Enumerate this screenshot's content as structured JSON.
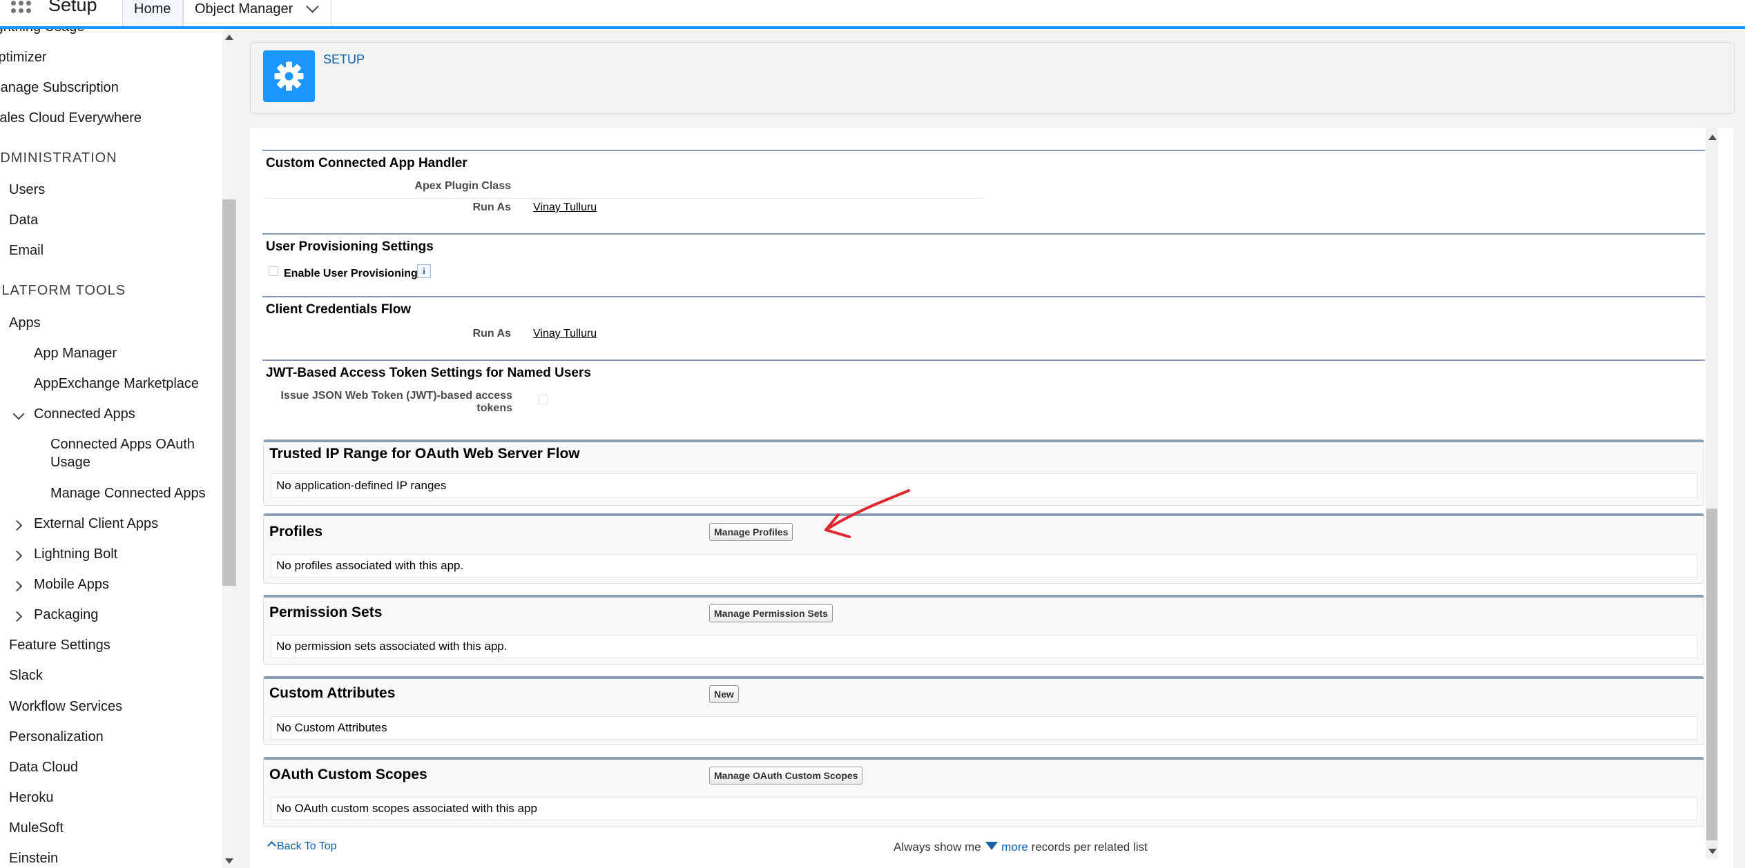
{
  "header": {
    "app_name": "Setup",
    "tabs": [
      {
        "label": "Home"
      },
      {
        "label": "Object Manager"
      }
    ]
  },
  "sidebar": {
    "items": {
      "lightning_usage": "Lightning Usage",
      "optimizer": "Optimizer",
      "manage_subscription": "Manage Subscription",
      "sales_cloud_everywhere": "Sales Cloud Everywhere",
      "administration": "ADMINISTRATION",
      "users": "Users",
      "data": "Data",
      "email": "Email",
      "platform_tools": "PLATFORM TOOLS",
      "apps": "Apps",
      "app_manager": "App Manager",
      "appexchange": "AppExchange Marketplace",
      "connected_apps": "Connected Apps",
      "connected_apps_oauth_1": "Connected Apps OAuth",
      "connected_apps_oauth_2": "Usage",
      "manage_connected_apps": "Manage Connected Apps",
      "external_client_apps": "External Client Apps",
      "lightning_bolt": "Lightning Bolt",
      "mobile_apps": "Mobile Apps",
      "packaging": "Packaging",
      "feature_settings": "Feature Settings",
      "slack": "Slack",
      "workflow_services": "Workflow Services",
      "personalization": "Personalization",
      "data_cloud": "Data Cloud",
      "heroku": "Heroku",
      "mulesoft": "MuleSoft",
      "einstein": "Einstein"
    }
  },
  "setup_header": {
    "label": "SETUP"
  },
  "sections": {
    "custom_handler": {
      "title": "Custom Connected App Handler",
      "apex_label": "Apex Plugin Class",
      "run_as_label": "Run As",
      "run_as_value": "Vinay Tulluru"
    },
    "user_provisioning": {
      "title": "User Provisioning Settings",
      "enable_label": "Enable User Provisioning",
      "info": "i"
    },
    "client_credentials": {
      "title": "Client Credentials Flow",
      "run_as_label": "Run As",
      "run_as_value": "Vinay Tulluru"
    },
    "jwt": {
      "title": "JWT-Based Access Token Settings for Named Users",
      "label_line1": "Issue JSON Web Token (JWT)-based access",
      "label_line2": "tokens"
    }
  },
  "related_lists": {
    "trusted_ip": {
      "title": "Trusted IP Range for OAuth Web Server Flow",
      "body": "No application-defined IP ranges"
    },
    "profiles": {
      "title": "Profiles",
      "button": "Manage Profiles",
      "body": "No profiles associated with this app."
    },
    "permission_sets": {
      "title": "Permission Sets",
      "button": "Manage Permission Sets",
      "body": "No permission sets associated with this app."
    },
    "custom_attributes": {
      "title": "Custom Attributes",
      "button": "New",
      "body": "No Custom Attributes"
    },
    "oauth_scopes": {
      "title": "OAuth Custom Scopes",
      "button": "Manage OAuth Custom Scopes",
      "body": "No OAuth custom scopes associated with this app"
    }
  },
  "footer": {
    "back_to_top": "Back To Top",
    "always_show": "Always show me",
    "more": "more",
    "records_per_list": "records per related list"
  },
  "colors": {
    "accent": "#1b96ff",
    "link": "#0b5cab",
    "annotation_arrow": "#e0282e"
  }
}
